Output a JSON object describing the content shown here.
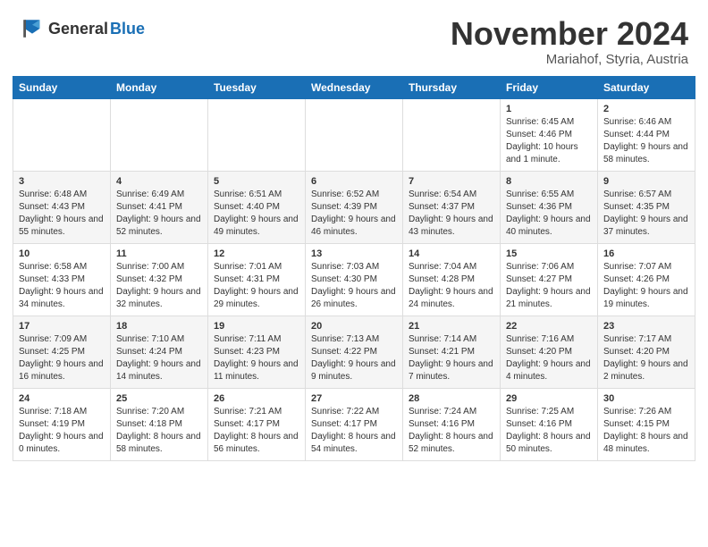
{
  "header": {
    "logo_general": "General",
    "logo_blue": "Blue",
    "month": "November 2024",
    "location": "Mariahof, Styria, Austria"
  },
  "weekdays": [
    "Sunday",
    "Monday",
    "Tuesday",
    "Wednesday",
    "Thursday",
    "Friday",
    "Saturday"
  ],
  "weeks": [
    [
      {
        "day": "",
        "info": ""
      },
      {
        "day": "",
        "info": ""
      },
      {
        "day": "",
        "info": ""
      },
      {
        "day": "",
        "info": ""
      },
      {
        "day": "",
        "info": ""
      },
      {
        "day": "1",
        "info": "Sunrise: 6:45 AM\nSunset: 4:46 PM\nDaylight: 10 hours and 1 minute."
      },
      {
        "day": "2",
        "info": "Sunrise: 6:46 AM\nSunset: 4:44 PM\nDaylight: 9 hours and 58 minutes."
      }
    ],
    [
      {
        "day": "3",
        "info": "Sunrise: 6:48 AM\nSunset: 4:43 PM\nDaylight: 9 hours and 55 minutes."
      },
      {
        "day": "4",
        "info": "Sunrise: 6:49 AM\nSunset: 4:41 PM\nDaylight: 9 hours and 52 minutes."
      },
      {
        "day": "5",
        "info": "Sunrise: 6:51 AM\nSunset: 4:40 PM\nDaylight: 9 hours and 49 minutes."
      },
      {
        "day": "6",
        "info": "Sunrise: 6:52 AM\nSunset: 4:39 PM\nDaylight: 9 hours and 46 minutes."
      },
      {
        "day": "7",
        "info": "Sunrise: 6:54 AM\nSunset: 4:37 PM\nDaylight: 9 hours and 43 minutes."
      },
      {
        "day": "8",
        "info": "Sunrise: 6:55 AM\nSunset: 4:36 PM\nDaylight: 9 hours and 40 minutes."
      },
      {
        "day": "9",
        "info": "Sunrise: 6:57 AM\nSunset: 4:35 PM\nDaylight: 9 hours and 37 minutes."
      }
    ],
    [
      {
        "day": "10",
        "info": "Sunrise: 6:58 AM\nSunset: 4:33 PM\nDaylight: 9 hours and 34 minutes."
      },
      {
        "day": "11",
        "info": "Sunrise: 7:00 AM\nSunset: 4:32 PM\nDaylight: 9 hours and 32 minutes."
      },
      {
        "day": "12",
        "info": "Sunrise: 7:01 AM\nSunset: 4:31 PM\nDaylight: 9 hours and 29 minutes."
      },
      {
        "day": "13",
        "info": "Sunrise: 7:03 AM\nSunset: 4:30 PM\nDaylight: 9 hours and 26 minutes."
      },
      {
        "day": "14",
        "info": "Sunrise: 7:04 AM\nSunset: 4:28 PM\nDaylight: 9 hours and 24 minutes."
      },
      {
        "day": "15",
        "info": "Sunrise: 7:06 AM\nSunset: 4:27 PM\nDaylight: 9 hours and 21 minutes."
      },
      {
        "day": "16",
        "info": "Sunrise: 7:07 AM\nSunset: 4:26 PM\nDaylight: 9 hours and 19 minutes."
      }
    ],
    [
      {
        "day": "17",
        "info": "Sunrise: 7:09 AM\nSunset: 4:25 PM\nDaylight: 9 hours and 16 minutes."
      },
      {
        "day": "18",
        "info": "Sunrise: 7:10 AM\nSunset: 4:24 PM\nDaylight: 9 hours and 14 minutes."
      },
      {
        "day": "19",
        "info": "Sunrise: 7:11 AM\nSunset: 4:23 PM\nDaylight: 9 hours and 11 minutes."
      },
      {
        "day": "20",
        "info": "Sunrise: 7:13 AM\nSunset: 4:22 PM\nDaylight: 9 hours and 9 minutes."
      },
      {
        "day": "21",
        "info": "Sunrise: 7:14 AM\nSunset: 4:21 PM\nDaylight: 9 hours and 7 minutes."
      },
      {
        "day": "22",
        "info": "Sunrise: 7:16 AM\nSunset: 4:20 PM\nDaylight: 9 hours and 4 minutes."
      },
      {
        "day": "23",
        "info": "Sunrise: 7:17 AM\nSunset: 4:20 PM\nDaylight: 9 hours and 2 minutes."
      }
    ],
    [
      {
        "day": "24",
        "info": "Sunrise: 7:18 AM\nSunset: 4:19 PM\nDaylight: 9 hours and 0 minutes."
      },
      {
        "day": "25",
        "info": "Sunrise: 7:20 AM\nSunset: 4:18 PM\nDaylight: 8 hours and 58 minutes."
      },
      {
        "day": "26",
        "info": "Sunrise: 7:21 AM\nSunset: 4:17 PM\nDaylight: 8 hours and 56 minutes."
      },
      {
        "day": "27",
        "info": "Sunrise: 7:22 AM\nSunset: 4:17 PM\nDaylight: 8 hours and 54 minutes."
      },
      {
        "day": "28",
        "info": "Sunrise: 7:24 AM\nSunset: 4:16 PM\nDaylight: 8 hours and 52 minutes."
      },
      {
        "day": "29",
        "info": "Sunrise: 7:25 AM\nSunset: 4:16 PM\nDaylight: 8 hours and 50 minutes."
      },
      {
        "day": "30",
        "info": "Sunrise: 7:26 AM\nSunset: 4:15 PM\nDaylight: 8 hours and 48 minutes."
      }
    ]
  ]
}
